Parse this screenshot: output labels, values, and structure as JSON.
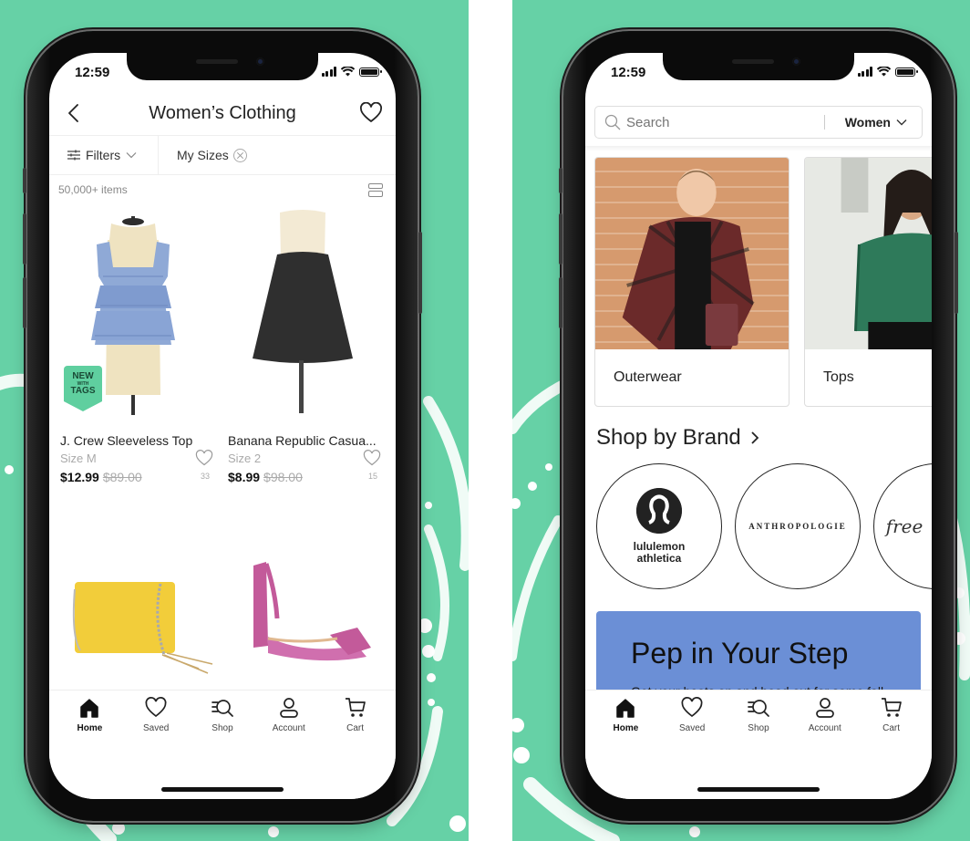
{
  "colors": {
    "background_green": "#66d1a6",
    "nwt_badge": "#5fcf9f",
    "promo_blue": "#6b8fd6"
  },
  "status_bar": {
    "time": "12:59"
  },
  "left_screen": {
    "header": {
      "title": "Women’s Clothing",
      "back_icon": "chevron-left-icon",
      "favorite_icon": "heart-outline-icon"
    },
    "filters": {
      "filters_label": "Filters",
      "chip_label": "My Sizes"
    },
    "results": {
      "count": "50,000+ items",
      "layout_icon": "list-layout-icon"
    },
    "products": [
      {
        "name": "J. Crew Sleeveless Top",
        "size": "Size M",
        "price": "$12.99",
        "original_price": "$89.00",
        "likes": "33",
        "badge": {
          "line1": "NEW",
          "line2": "WITH",
          "line3": "TAGS"
        },
        "image": "blue tiered sleeveless top on mannequin"
      },
      {
        "name": "Banana Republic Casua...",
        "size": "Size 2",
        "price": "$8.99",
        "original_price": "$98.00",
        "likes": "15",
        "image": "black a-line skirt on mannequin"
      },
      {
        "name": "",
        "image": "yellow crossbody bag with chain strap"
      },
      {
        "name": "",
        "image": "pink block-heel sandal"
      }
    ]
  },
  "right_screen": {
    "search": {
      "placeholder": "Search",
      "gender_selected": "Women"
    },
    "categories": [
      {
        "label": "Outerwear",
        "image": "woman in plaid jacket against brick wall"
      },
      {
        "label": "Tops",
        "image": "woman in green blouse"
      }
    ],
    "shop_by_brand": {
      "heading": "Shop by Brand",
      "brands": [
        {
          "name_line1": "lululemon",
          "name_line2": "athletica"
        },
        {
          "name": "ANTHROPOLOGIE"
        },
        {
          "name": "free"
        }
      ]
    },
    "promo": {
      "title": "Pep in Your Step",
      "text": "Get your boots on and head out for some fall fun."
    }
  },
  "tab_bar": {
    "tabs": [
      {
        "label": "Home",
        "icon": "home-icon",
        "active": true
      },
      {
        "label": "Saved",
        "icon": "heart-icon",
        "active": false
      },
      {
        "label": "Shop",
        "icon": "shop-search-icon",
        "active": false
      },
      {
        "label": "Account",
        "icon": "account-icon",
        "active": false
      },
      {
        "label": "Cart",
        "icon": "cart-icon",
        "active": false
      }
    ]
  }
}
